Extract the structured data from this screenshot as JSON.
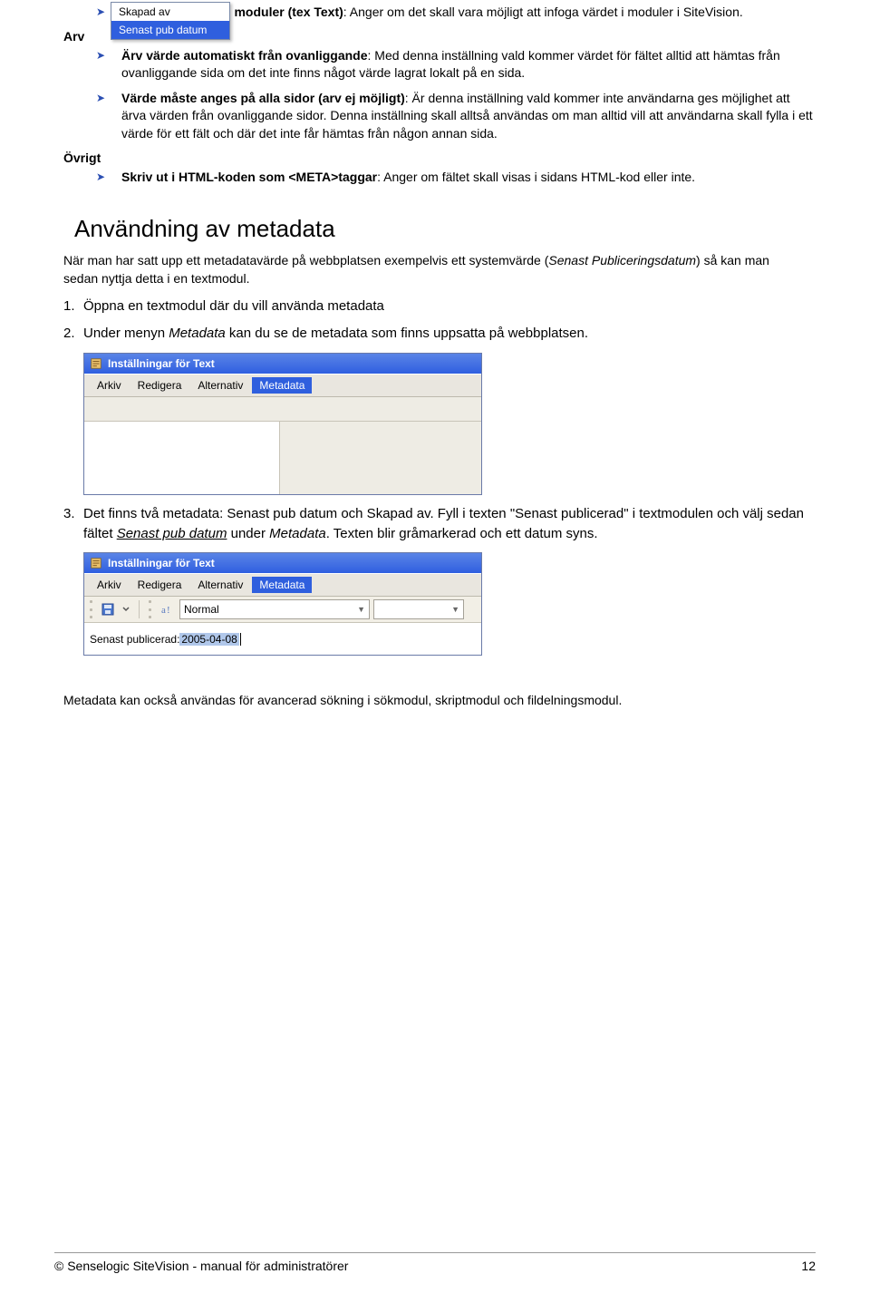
{
  "bullets": {
    "b1_lead": "Fältet får infogas i moduler (tex Text)",
    "b1_rest": ": Anger om det skall vara möjligt att infoga värdet i moduler i SiteVision.",
    "arv_label": "Arv",
    "b2_lead": "Ärv värde automatiskt från ovanliggande",
    "b2_rest": ": Med denna inställning vald kommer värdet för fältet alltid att hämtas från ovanliggande sida om det inte finns något värde lagrat lokalt på en sida.",
    "b3_lead": "Värde måste anges på alla sidor (arv ej möjligt)",
    "b3_rest": ": Är denna inställning vald kommer inte användarna ges möjlighet att ärva värden från ovanliggande sidor. Denna inställning skall alltså användas om man alltid vill att användarna skall fylla i ett värde för ett fält och där det inte får hämtas från någon annan sida.",
    "ovrigt_label": "Övrigt",
    "b4_lead": "Skriv ut i HTML-koden som <META>taggar",
    "b4_rest": ": Anger om fältet skall visas i sidans HTML-kod eller inte."
  },
  "heading": "Användning av metadata",
  "para1a": "När man har satt upp ett metadatavärde på webbplatsen exempelvis ett systemvärde (",
  "para1b": "Senast Publiceringsdatum",
  "para1c": ") så kan man sedan nyttja detta i en textmodul.",
  "list": {
    "n1": "1.",
    "n1_text": "Öppna en textmodul där du vill använda metadata",
    "n2": "2.",
    "n2_text_a": "Under menyn ",
    "n2_text_b": "Metadata",
    "n2_text_c": " kan du se de metadata som finns uppsatta på webbplatsen.",
    "n3": "3.",
    "n3_text_a": "Det finns två metadata: Senast pub datum och Skapad av. Fyll i texten \"Senast publicerad\" i textmodulen och välj sedan fältet ",
    "n3_text_b": "Senast pub datum",
    "n3_text_c": " under ",
    "n3_text_d": "Metadata",
    "n3_text_e": ". Texten blir gråmarkerad och ett datum syns."
  },
  "shot1": {
    "title": "Inställningar för Text",
    "menu": {
      "arkiv": "Arkiv",
      "redigera": "Redigera",
      "alternativ": "Alternativ",
      "metadata": "Metadata"
    },
    "dd1": "Skapad av",
    "dd2": "Senast pub datum"
  },
  "shot2": {
    "title": "Inställningar för Text",
    "menu": {
      "arkiv": "Arkiv",
      "redigera": "Redigera",
      "alternativ": "Alternativ",
      "metadata": "Metadata"
    },
    "combo_style": "Normal",
    "editor_prefix": "Senast publicerad: ",
    "editor_selection": "2005-04-08"
  },
  "closing": "Metadata kan också användas för avancerad sökning i sökmodul, skriptmodul och fildelningsmodul.",
  "footer": {
    "left": "© Senselogic SiteVision - manual för administratörer",
    "right": "12"
  }
}
